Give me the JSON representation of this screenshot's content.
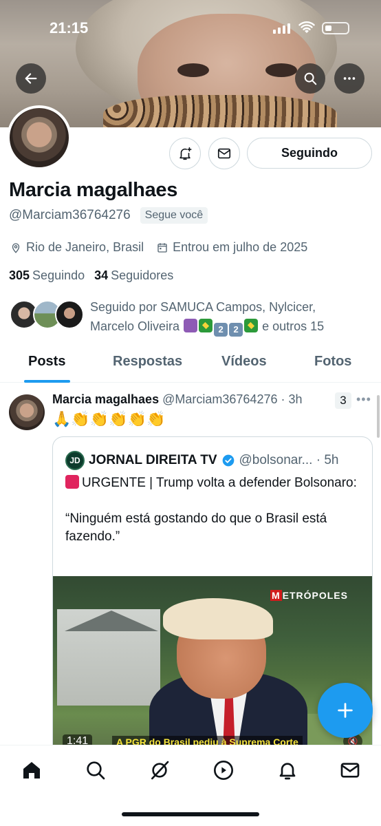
{
  "status_bar": {
    "time": "21:15"
  },
  "profile": {
    "name": "Marcia magalhaes",
    "handle": "@Marciam36764276",
    "follows_you": "Segue você",
    "location": "Rio de Janeiro, Brasil",
    "joined": "Entrou em julho de 2025",
    "following_count": "305",
    "following_label": "Seguindo",
    "followers_count": "34",
    "followers_label": "Seguidores",
    "follow_button": "Seguindo",
    "followed_by_prefix": "Seguido por SAMUCA Campos, Nylcicer,",
    "followed_by_line2": "Marcelo Oliveira",
    "followed_by_suffix": "e outros 15"
  },
  "tabs": [
    "Posts",
    "Respostas",
    "Vídeos",
    "Fotos"
  ],
  "post": {
    "author": "Marcia magalhaes",
    "handle_time": "@Marciam36764276 · 3h",
    "grok_count": "3",
    "text": "🙏👏👏👏👏👏",
    "quote": {
      "logo": "JD",
      "name": "JORNAL DIREITA TV",
      "handle_time": "@bolsonar... · 5h",
      "line1": "URGENTE | Trump volta a defender Bolsonaro:",
      "line2": "“Ninguém está gostando do que o Brasil está fazendo.”",
      "video": {
        "brand_prefix": "M",
        "brand_rest": "ETRÓPOLES",
        "duration": "1:41",
        "caption": "A PGR do Brasil pediu à Suprema Corte"
      }
    }
  },
  "icons": {
    "back": "arrow-left-icon",
    "search": "search-icon",
    "more": "more-icon",
    "notify": "bell-plus-icon",
    "message": "envelope-icon",
    "location": "location-pin-icon",
    "calendar": "calendar-icon",
    "verified": "verified-badge-icon",
    "compose": "plus-icon"
  },
  "nav": [
    "home-icon",
    "search-icon",
    "grok-icon",
    "play-icon",
    "bell-icon",
    "envelope-icon"
  ],
  "colors": {
    "accent": "#1d9bf0",
    "text": "#0f1419",
    "muted": "#536471"
  }
}
